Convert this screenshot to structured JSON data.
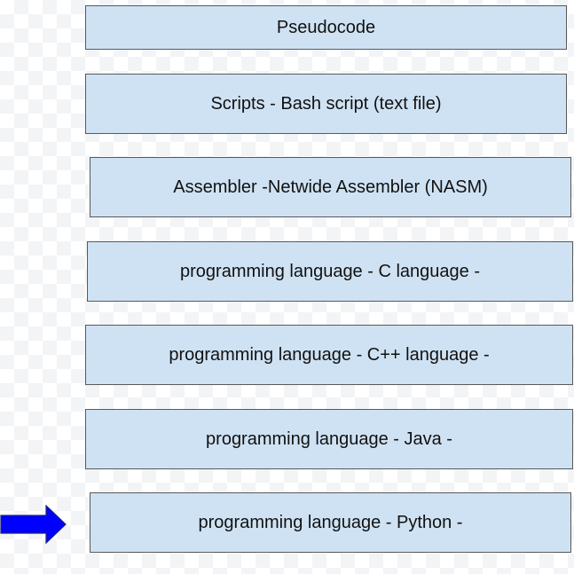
{
  "diagram": {
    "boxes": [
      {
        "label": "Pseudocode"
      },
      {
        "label": "Scripts - Bash script (text file)"
      },
      {
        "label": "Assembler -Netwide Assembler (NASM)"
      },
      {
        "label": "programming language - C language -"
      },
      {
        "label": "programming language - C++ language -"
      },
      {
        "label": "programming language - Java -"
      },
      {
        "label": "programming language - Python -"
      }
    ],
    "box_fill_color": "#cfe2f3",
    "box_border_color": "#595959",
    "pointer": {
      "icon": "right-arrow-icon",
      "color": "#0000ff",
      "points_to": "programming language - Python -"
    }
  }
}
